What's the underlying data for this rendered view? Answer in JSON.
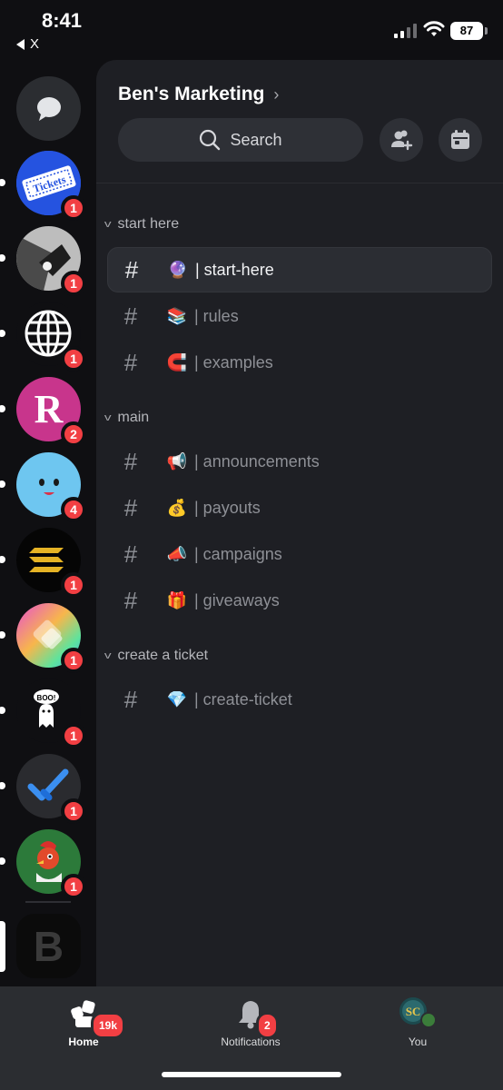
{
  "status_bar": {
    "time": "8:41",
    "back_app": "X",
    "battery": "87"
  },
  "guilds": [
    {
      "name": "dm",
      "badge": ""
    },
    {
      "name": "tickets",
      "badge": "1",
      "image_text": "Tickets"
    },
    {
      "name": "bird",
      "badge": "1"
    },
    {
      "name": "globe",
      "badge": "1"
    },
    {
      "name": "r-server",
      "badge": "2",
      "image_text": "R"
    },
    {
      "name": "smiley",
      "badge": "4"
    },
    {
      "name": "solana",
      "badge": "1"
    },
    {
      "name": "gradient",
      "badge": "1"
    },
    {
      "name": "ghost",
      "badge": "1",
      "image_text": "BOO!"
    },
    {
      "name": "checkmark",
      "badge": "1"
    },
    {
      "name": "rooster",
      "badge": "1"
    },
    {
      "name": "b-server",
      "badge": "",
      "image_text": "B"
    }
  ],
  "server": {
    "name": "Ben's Marketing",
    "search_label": "Search"
  },
  "categories": [
    {
      "name": "start here",
      "channels": [
        {
          "emoji": "🔮",
          "name": "| start-here",
          "active": true
        },
        {
          "emoji": "📚",
          "name": "| rules"
        },
        {
          "emoji": "🧲",
          "name": "| examples"
        }
      ]
    },
    {
      "name": "main",
      "channels": [
        {
          "emoji": "📢",
          "name": "| announcements"
        },
        {
          "emoji": "💰",
          "name": "| payouts"
        },
        {
          "emoji": "📣",
          "name": "| campaigns"
        },
        {
          "emoji": "🎁",
          "name": "| giveaways"
        }
      ]
    },
    {
      "name": "create a ticket",
      "channels": [
        {
          "emoji": "💎",
          "name": "| create-ticket"
        }
      ]
    }
  ],
  "bottom_nav": {
    "home": {
      "label": "Home",
      "badge": "19k"
    },
    "notifications": {
      "label": "Notifications",
      "badge": "2"
    },
    "you": {
      "label": "You",
      "avatar_text": "SC"
    }
  }
}
